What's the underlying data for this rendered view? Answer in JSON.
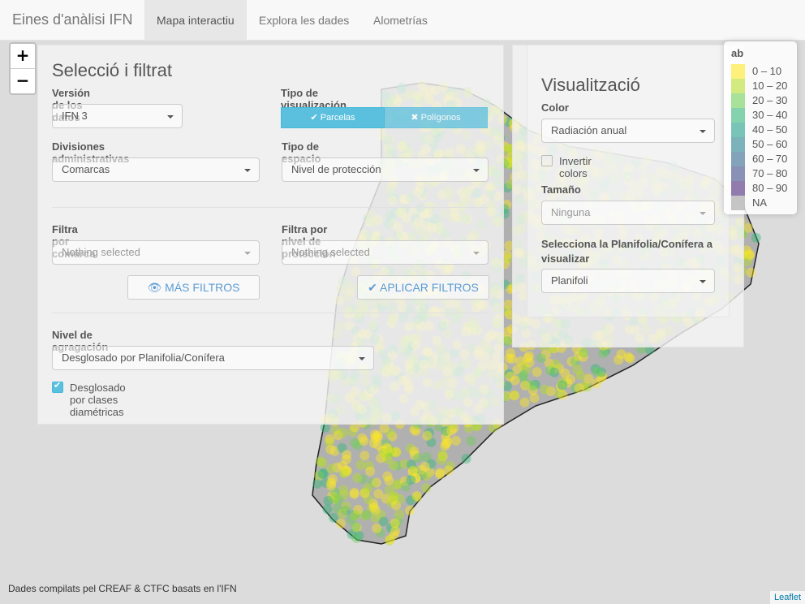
{
  "nav": {
    "brand": "Eines d'anàlisi IFN",
    "tabs": [
      "Mapa interactiu",
      "Explora les dades",
      "Alometrías"
    ]
  },
  "zoom": {
    "in": "+",
    "out": "−"
  },
  "filter_panel": {
    "title": "Selecció i filtrat",
    "version_label": "Versión de los datos",
    "version_value": "IFN 3",
    "viz_type_label": "Tipo de visualización",
    "viz_parcelas": "✔ Parcelas",
    "viz_poligonos": "✖ Polígonos",
    "admin_label": "Divisiones administrativas",
    "admin_value": "Comarcas",
    "espacio_label": "Tipo de espacio",
    "espacio_value": "Nivel de protección",
    "comarca_filter_label": "Filtra por comarca",
    "comarca_filter_placeholder": "Nothing selected",
    "proteccion_filter_label": "Filtra por nivel de protección",
    "proteccion_filter_placeholder": "Nothing selected",
    "more_filters": "MÁS FILTROS",
    "apply_filters": "APLICAR FILTROS",
    "agregacion_label": "Nivel de agragación",
    "agregacion_value": "Desglosado por Planifolia/Conífera",
    "diametric_label": "Desglosado por clases diamétricas"
  },
  "viz_panel": {
    "title": "Visualització",
    "color_label": "Color",
    "color_value": "Radiación anual",
    "invert_label": "Invertir colors",
    "size_label": "Tamaño",
    "size_value": "Ninguna",
    "planifolia_label": "Selecciona la Planifolia/Conífera a visualizar",
    "planifolia_value": "Planifoli"
  },
  "legend": {
    "title": "ab",
    "items": [
      {
        "label": "0 – 10",
        "color": "#fde725"
      },
      {
        "label": "10 – 20",
        "color": "#b5de2b"
      },
      {
        "label": "20 – 30",
        "color": "#6ece58"
      },
      {
        "label": "30 – 40",
        "color": "#35b779"
      },
      {
        "label": "40 – 50",
        "color": "#1f9e89"
      },
      {
        "label": "50 – 60",
        "color": "#26828e"
      },
      {
        "label": "60 – 70",
        "color": "#31688e"
      },
      {
        "label": "70 – 80",
        "color": "#3e4a89"
      },
      {
        "label": "80 – 90",
        "color": "#482878"
      },
      {
        "label": "NA",
        "color": "#a0a0a0"
      }
    ]
  },
  "footer": {
    "credit": "Dades compilats pel CREAF & CTFC basats en l'IFN",
    "attribution": "Leaflet"
  }
}
